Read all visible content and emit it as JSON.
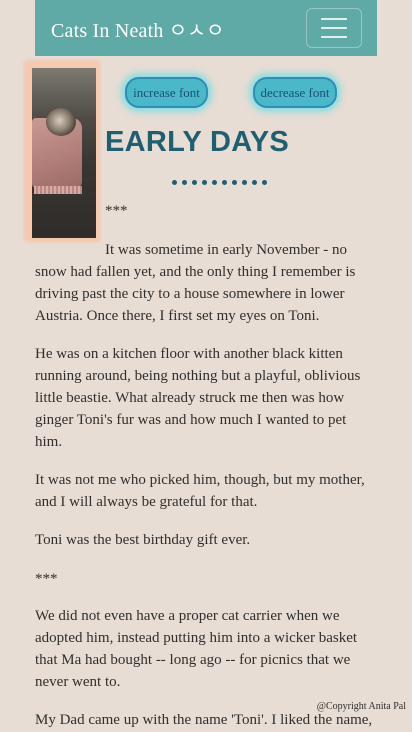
{
  "navbar": {
    "brand": "Cats In Neath ㅇㅅㅇ",
    "menu_icon": "hamburger-menu-icon"
  },
  "photo": {
    "description_icon": "cat-photo"
  },
  "controls": {
    "increase_label": "increase font",
    "decrease_label": "decrease font"
  },
  "article": {
    "title": "EARLY DAYS",
    "separator_top": "***",
    "paragraphs": [
      "It was sometime in early November - no snow had fallen yet, and the only thing I remember is driving past the city to a house somewhere in lower Austria. Once there, I first set my eyes on Toni.",
      "He was on a kitchen floor with another black kitten running around, being nothing but a playful, oblivious little beastie. What already struck me then was how ginger Toni's fur was and how much I wanted to pet him.",
      "It was not me who picked him, though, but my mother, and I will always be grateful for that.",
      "Toni was the best birthday gift ever.",
      "***",
      "We did not even have a proper cat carrier when we adopted him, instead putting him into a wicker basket that Ma had bought -- long ago -- for picnics that we never went to.",
      "My Dad came up with the name 'Toni'. I liked the name,"
    ]
  },
  "footer": {
    "copyright": "@Copyright Anita Pal"
  },
  "colors": {
    "background": "#e8ddd4",
    "navbar": "#5fa9a6",
    "title": "#1f5f72",
    "button": "#4bb8c9",
    "photo_border": "#f6c9b1"
  }
}
